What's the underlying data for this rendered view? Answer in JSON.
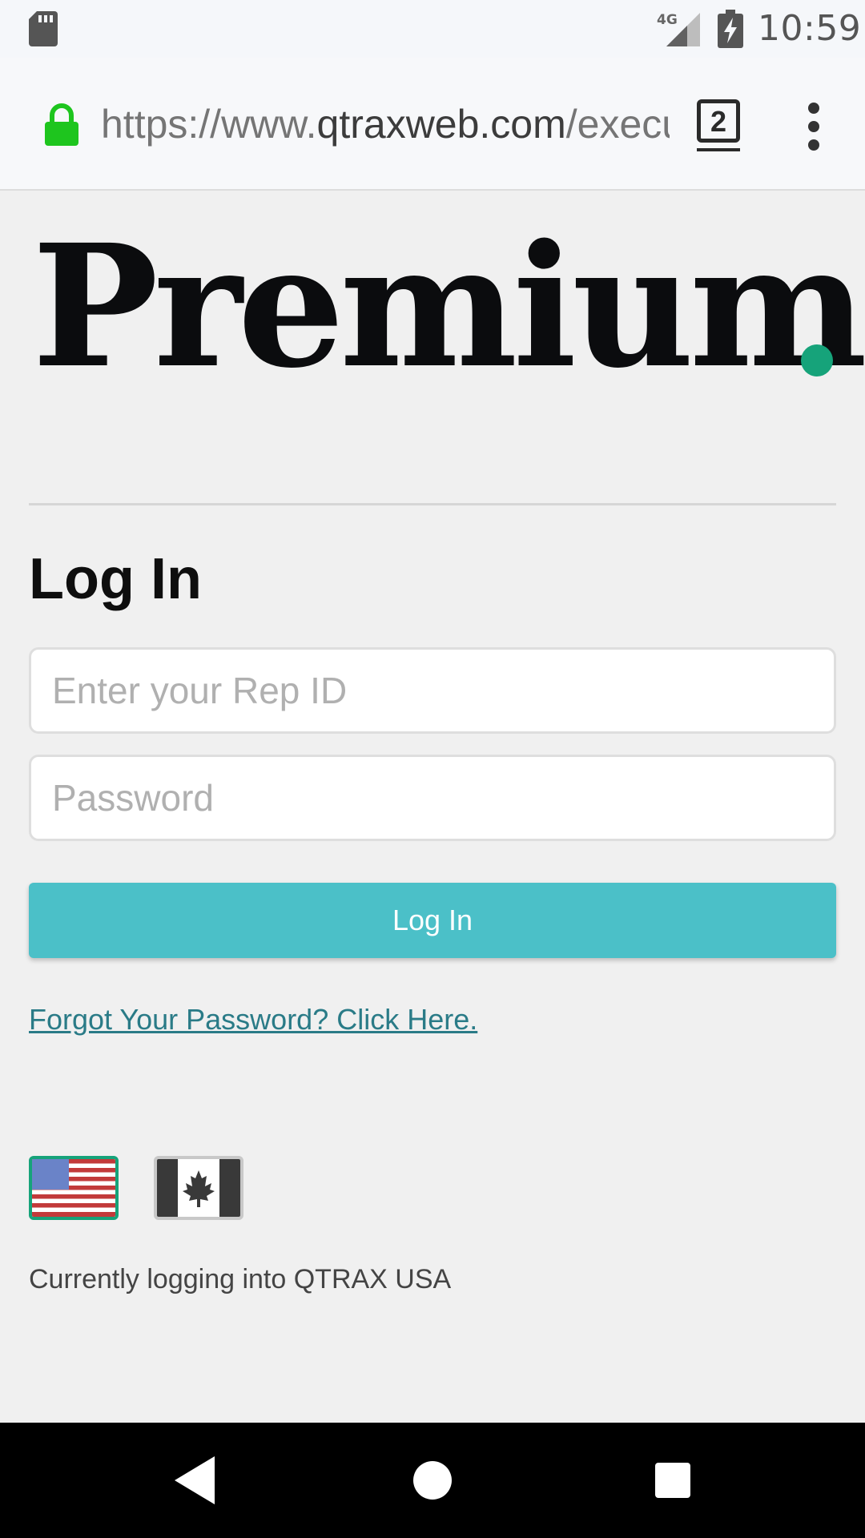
{
  "status_bar": {
    "network": "4G",
    "time": "10:59",
    "icons": [
      "sd-card-icon",
      "signal-icon",
      "battery-charging-icon"
    ]
  },
  "browser": {
    "url_prefix": "https://www.",
    "url_domain": "qtraxweb.com",
    "url_suffix": "/execu",
    "tab_count": "2",
    "icons": [
      "lock-icon",
      "more-vert-icon"
    ],
    "lock_color": "#1ec51e"
  },
  "page": {
    "logo_text": "Premium",
    "logo_dot_color": "#16a37a",
    "heading": "Log In",
    "rep_id_placeholder": "Enter your Rep ID",
    "password_placeholder": "Password",
    "login_button_label": "Log In",
    "button_color": "#4bc0c8",
    "forgot_link": "Forgot Your Password? Click Here.",
    "link_color": "#2a7b87",
    "flags": [
      {
        "country": "USA",
        "icon": "us-flag-icon",
        "selected": true
      },
      {
        "country": "Canada",
        "icon": "canada-flag-icon",
        "selected": false
      }
    ],
    "current_login_text": "Currently logging into QTRAX USA"
  },
  "nav_bar": {
    "icons": [
      "back-icon",
      "home-icon",
      "recent-apps-icon"
    ]
  }
}
